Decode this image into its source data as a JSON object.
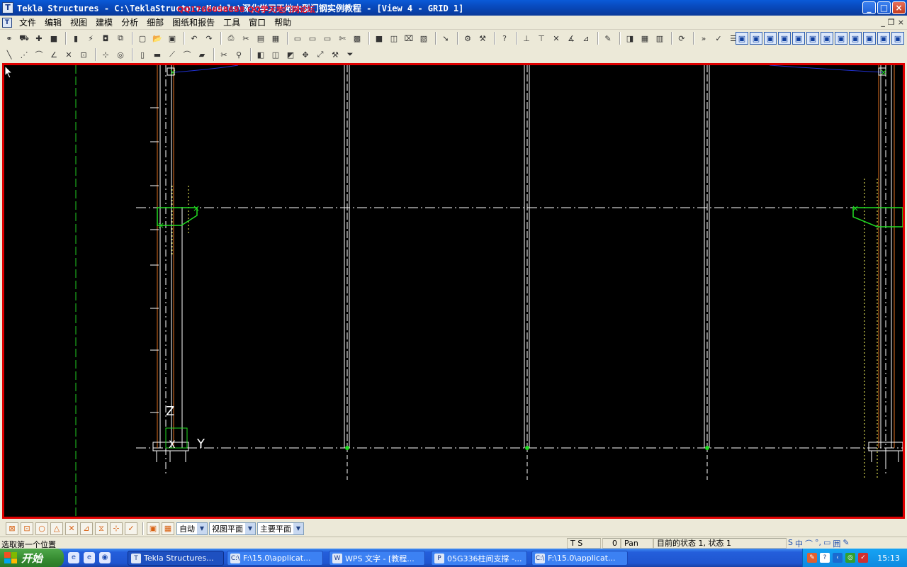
{
  "window": {
    "title": "Tekla Structures - C:\\TeklaStructuresModels\\深化学习天地大型门钢实例教程 - [View 4 - GRID 1]",
    "overlay_text": "QQ1766658688   QQ学天地门网论坛",
    "min": "_",
    "max": "□",
    "close": "×"
  },
  "menu": {
    "items": [
      "文件",
      "编辑",
      "视图",
      "建模",
      "分析",
      "细部",
      "图纸和报告",
      "工具",
      "窗口",
      "帮助"
    ],
    "mdi_min": "_",
    "mdi_restore": "❐",
    "mdi_close": "×"
  },
  "toolbar1": {
    "icons": [
      "binoculars-icon",
      "car-icon",
      "create-icon",
      "box-icon",
      "sep",
      "column-icon",
      "connect-icon",
      "save-model-icon",
      "copy-icon",
      "sep",
      "new-icon",
      "open-icon",
      "save-icon",
      "sep",
      "undo-icon",
      "redo-icon",
      "sep",
      "print-icon",
      "cut-icon",
      "paste-icon",
      "props-icon",
      "sep",
      "window1-icon",
      "window2-icon",
      "window3-icon",
      "scissors-icon",
      "grid-icon",
      "sep",
      "orange-box-icon",
      "multi-box-icon",
      "frame-icon",
      "folder-icon",
      "sep",
      "arrow-icon",
      "sep",
      "bolt-icon",
      "weld-icon",
      "sep",
      "help-icon",
      "sep",
      "dim1-icon",
      "dim2-icon",
      "dim3-icon",
      "dim4-icon",
      "dim5-icon",
      "sep",
      "pencil-icon",
      "sep",
      "plane1-icon",
      "plane2-icon",
      "plane3-icon",
      "sep",
      "rotate-icon",
      "sep",
      "chevron-icon",
      "select-icon",
      "stack-icon"
    ],
    "right_icons": [
      "select-all-icon",
      "select-part-icon",
      "select-surface-icon",
      "select-weld-icon",
      "select-grid-icon",
      "select-point-icon",
      "select-cut-icon",
      "select-bolt-icon",
      "select-comp-icon",
      "select-view-icon",
      "select-ref-icon",
      "select-sym-icon"
    ]
  },
  "toolbar2": {
    "icons": [
      "line-icon",
      "polyline-icon",
      "arc-icon",
      "angle-icon",
      "cross-icon",
      "dim-snap-icon",
      "sep",
      "node-icon",
      "circle-snap-icon",
      "sep",
      "beam-icon",
      "column-plate-icon",
      "brace-icon",
      "curved-beam-icon",
      "slab-icon",
      "sep",
      "red-cut-icon",
      "user-icon",
      "sep",
      "cube-icon",
      "cube2-icon",
      "cube3-icon",
      "move-icon",
      "fit-icon",
      "hammer-icon",
      "funnel-icon"
    ]
  },
  "bottombar": {
    "buttons": [
      "snap-end-icon",
      "snap-mid-icon",
      "snap-circle-icon",
      "snap-tri-icon",
      "snap-cross-icon",
      "snap-perp-icon",
      "snap-hour-icon",
      "snap-node-icon",
      "snap-check-icon",
      "sep",
      "snap-plane-icon",
      "snap-grid-icon"
    ],
    "selects": [
      {
        "value": "自动"
      },
      {
        "value": "视图平面"
      },
      {
        "value": "主要平面"
      }
    ]
  },
  "statusbar": {
    "prompt": "选取第一个位置",
    "ts": "T S",
    "num": "0",
    "mode": "Pan",
    "state": "目前的状态 1, 状态 1"
  },
  "ime": [
    "S",
    "中",
    "⌒",
    "°,",
    "▭",
    "囲",
    "✎"
  ],
  "taskbar": {
    "start": "开始",
    "tasks": [
      {
        "label": "Tekla Structures...",
        "icon": "T",
        "active": true
      },
      {
        "label": "F:\\15.0\\applicat...",
        "icon": "C:\\",
        "active": false
      },
      {
        "label": "WPS 文字 - [教程...",
        "icon": "W",
        "active": false
      },
      {
        "label": "05G336柱间支撑 -...",
        "icon": "P",
        "active": false
      },
      {
        "label": "F:\\15.0\\applicat...",
        "icon": "C:\\",
        "active": false
      }
    ],
    "clock": "15:13"
  },
  "viewport": {
    "labels": {
      "z": "Z",
      "y": "Y",
      "x": "X"
    },
    "colors": {
      "frame": "#e00000",
      "grid": "#ffffff",
      "green": "#22dd22",
      "orange": "#e07020"
    }
  }
}
